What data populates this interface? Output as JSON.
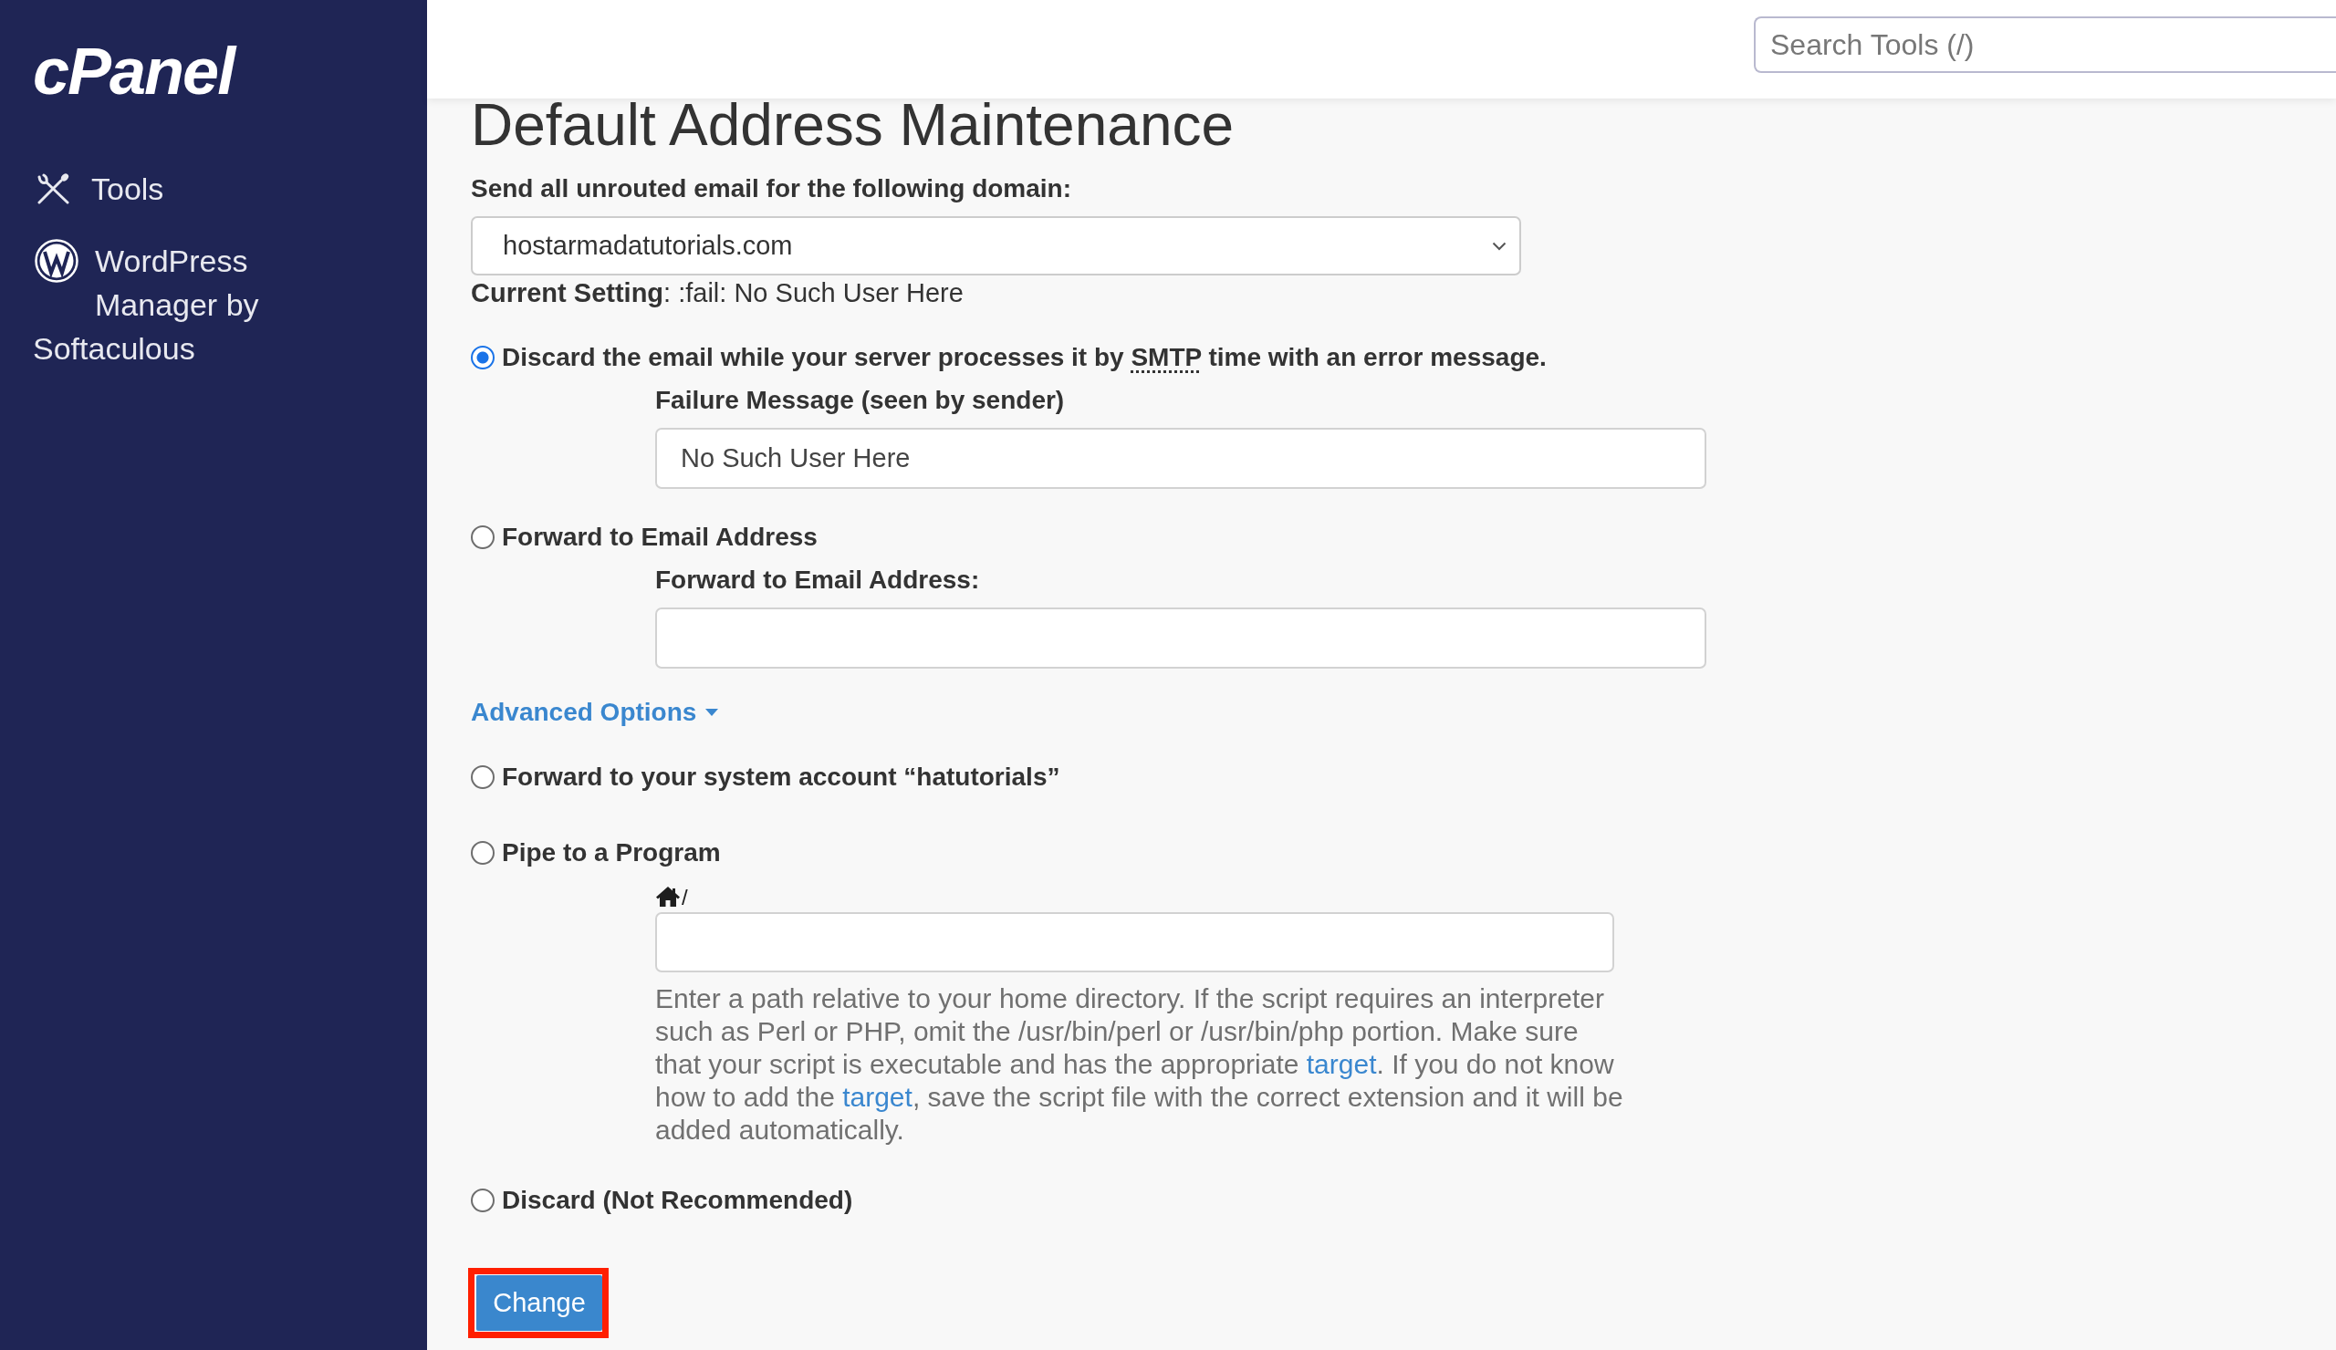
{
  "sidebar": {
    "logo": "cPanel",
    "items": [
      {
        "kind": "tools",
        "label": "Tools"
      },
      {
        "kind": "wordpress",
        "label": "WordPress Manager by Softaculous"
      }
    ]
  },
  "search": {
    "placeholder": "Search Tools (/)"
  },
  "page": {
    "title": "Default Address Maintenance"
  },
  "domain": {
    "label": "Send all unrouted email for the following domain:",
    "value": "hostarmadatutorials.com"
  },
  "current_setting": "**Current Setting**: :fail: No Such User Here",
  "options": [
    {
      "label_parts": [
        {
          "text": "Discard the email while your server processes it by "
        },
        {
          "text": "SMTP",
          "kind": "abbr"
        },
        {
          "text": " time with an error message."
        }
      ],
      "selected": true,
      "field": {
        "kind": "text",
        "label": "Failure Message (seen by sender)",
        "value": "No Such User Here"
      }
    },
    {
      "label": "Forward to Email Address",
      "selected": false,
      "field": {
        "kind": "text",
        "label": "Forward to Email Address:"
      }
    }
  ],
  "advanced": {
    "label": "Advanced Options",
    "expanded": true,
    "options": [
      {
        "label": "Forward to your system account “hatutorials”",
        "selected": false
      },
      {
        "label": "Pipe to a Program",
        "selected": false,
        "field": {
          "kind": "path",
          "prefix": "/",
          "help": [
            {
              "text": "Enter a path relative to your home directory. If the script requires an interpreter such as Perl or PHP, omit the /usr/bin/perl or /usr/bin/php portion. Make sure that your script is executable and has the appropriate "
            },
            {
              "text": "target",
              "kind": "link"
            },
            {
              "text": ". If you do not know how to add the "
            },
            {
              "text": "target",
              "kind": "link"
            },
            {
              "text": ", save the script file with the correct extension and it will be added automatically."
            }
          ]
        }
      },
      {
        "label": "Discard (Not Recommended)",
        "selected": false
      }
    ]
  },
  "submit": {
    "label": "Change",
    "highlighted": true
  }
}
